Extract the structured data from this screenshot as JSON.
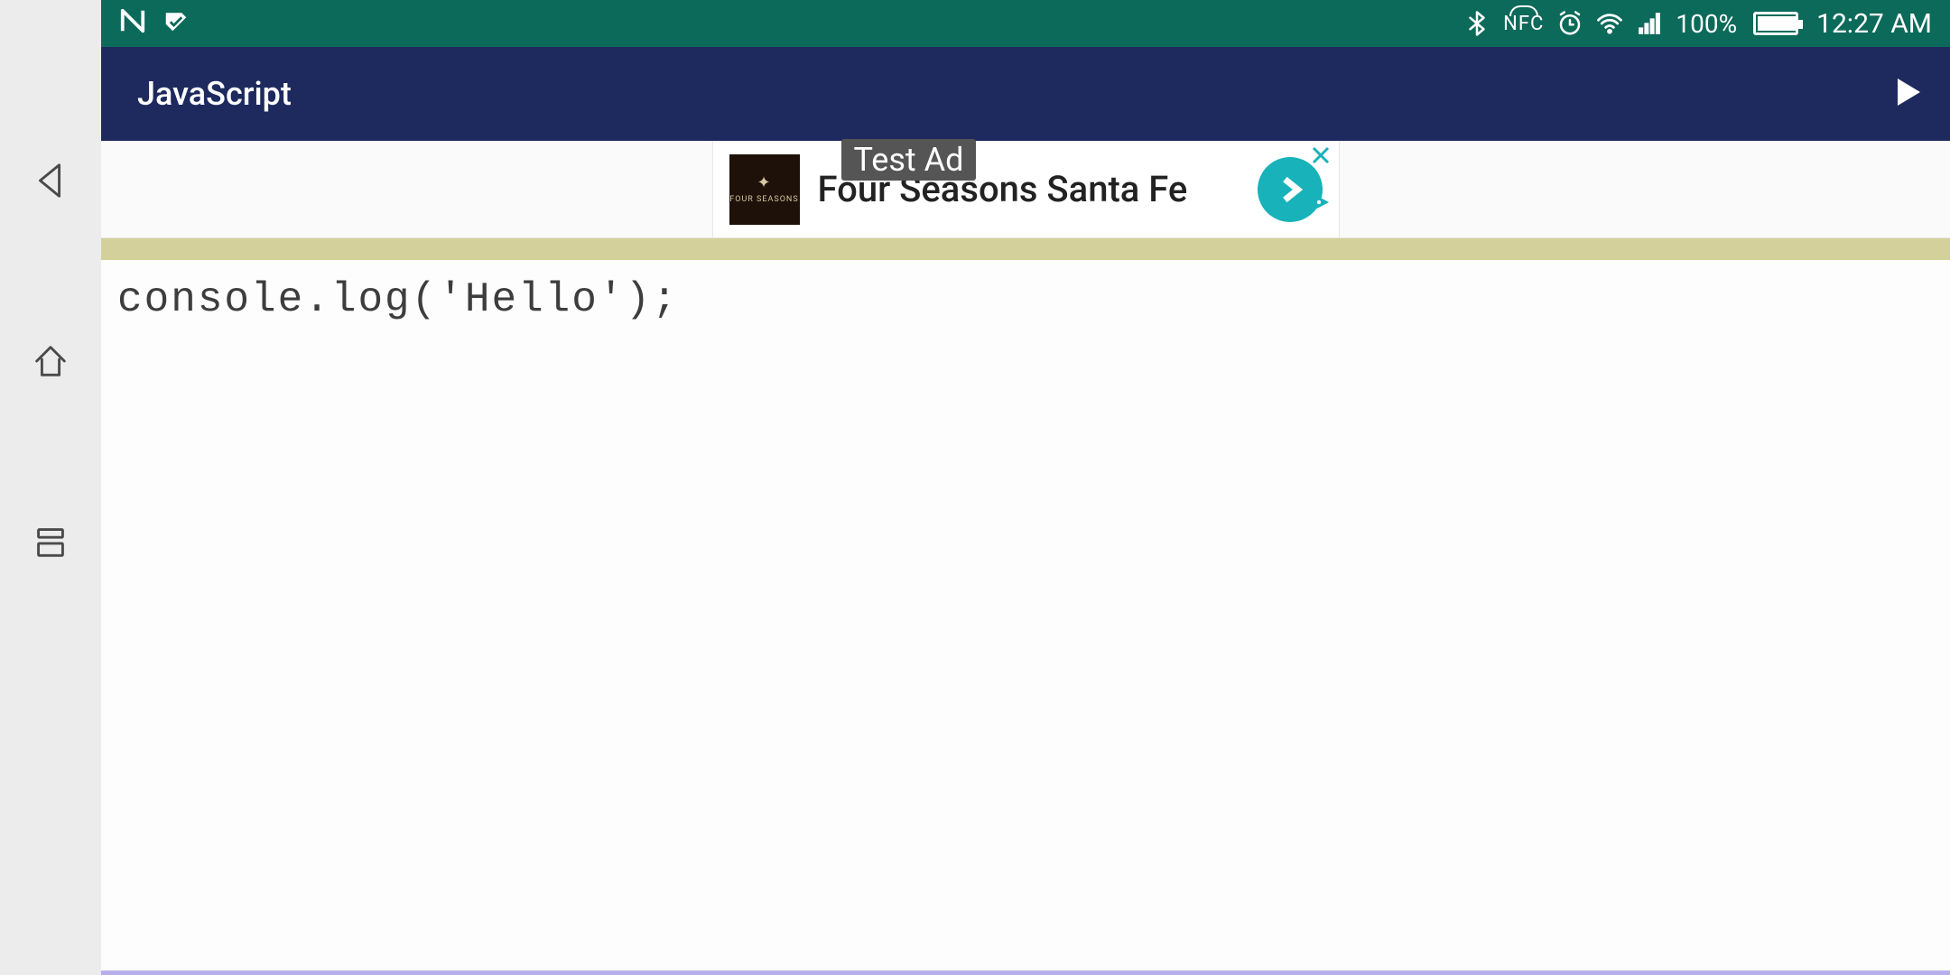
{
  "status_bar": {
    "nfc_label": "NFC",
    "battery_percent": "100%",
    "time": "12:27 AM"
  },
  "toolbar": {
    "title": "JavaScript"
  },
  "ad": {
    "brand": "FOUR SEASONS",
    "headline": "Four Seasons Santa Fe",
    "overlay_label": "Test Ad"
  },
  "editor": {
    "code": "console.log('Hello');"
  }
}
